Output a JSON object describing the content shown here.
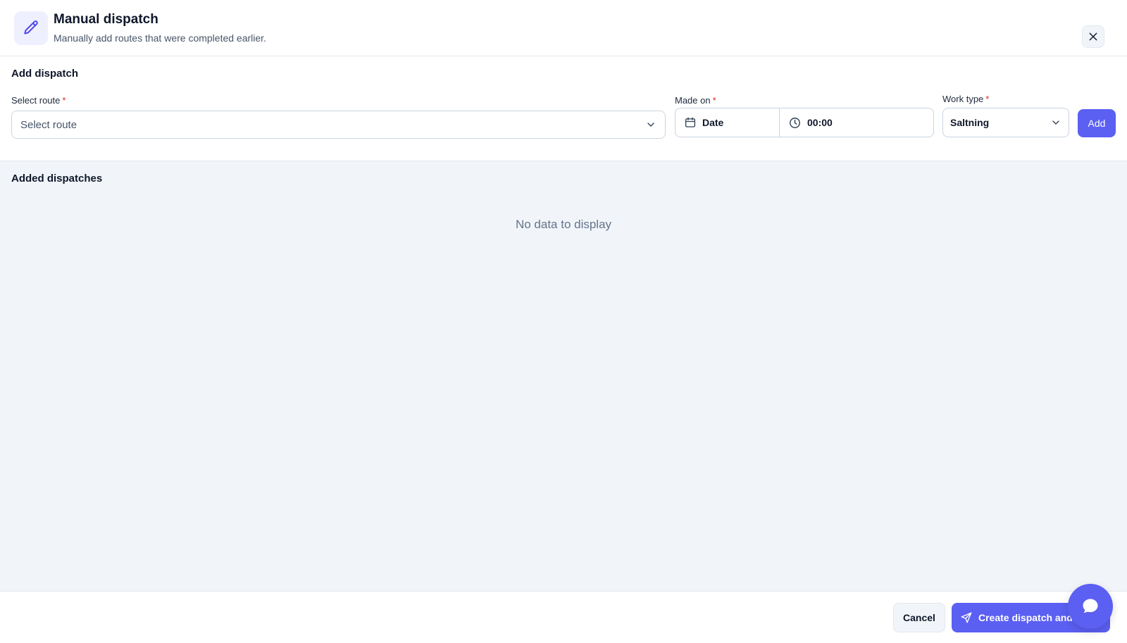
{
  "header": {
    "title": "Manual dispatch",
    "subtitle": "Manually add routes that were completed earlier.",
    "icon": "pencil-icon",
    "close_icon": "close-icon"
  },
  "add_section": {
    "title": "Add dispatch",
    "route": {
      "label": "Select route",
      "required_mark": "*",
      "placeholder": "Select route"
    },
    "made_on": {
      "label": "Made on",
      "required_mark": "*",
      "date_placeholder": "Date",
      "time_value": "00:00"
    },
    "work_type": {
      "label": "Work type",
      "required_mark": "*",
      "value": "Saltning"
    },
    "add_label": "Add"
  },
  "list_section": {
    "title": "Added dispatches",
    "empty_text": "No data to display"
  },
  "footer": {
    "cancel_label": "Cancel",
    "create_label": "Create dispatch and in"
  },
  "colors": {
    "accent": "#5b5ff2",
    "required": "#dc2626",
    "panel_bg": "#f1f5f9"
  }
}
